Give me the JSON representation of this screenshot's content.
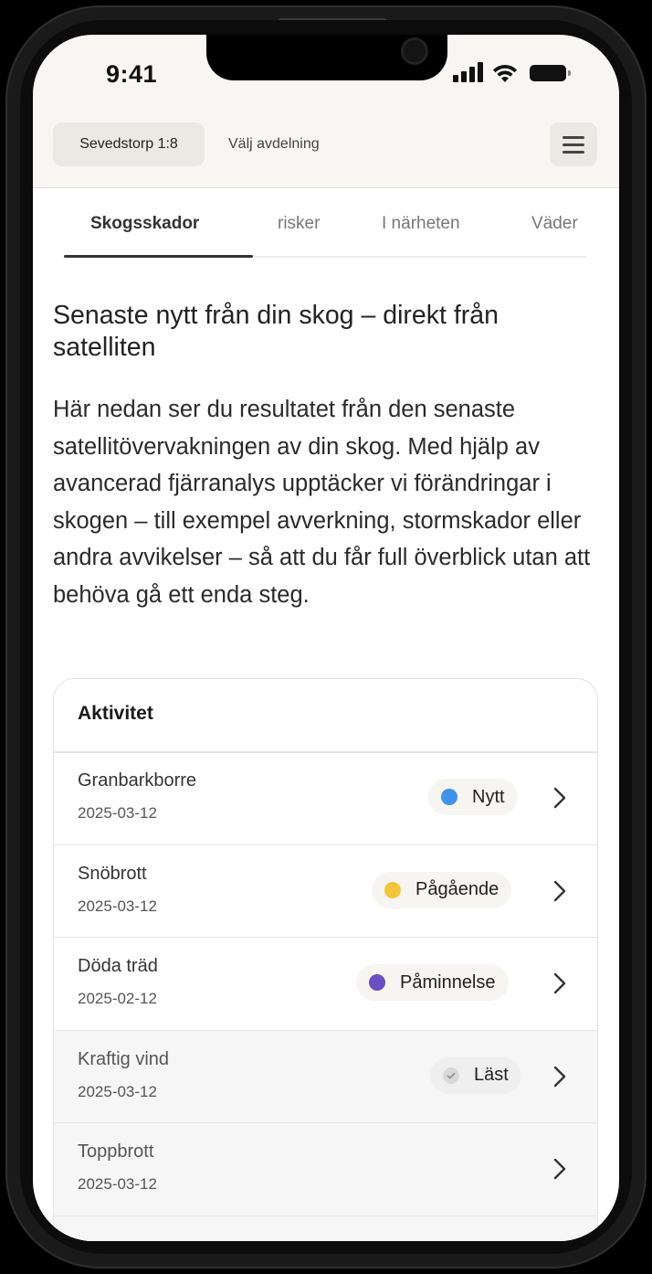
{
  "status_bar": {
    "time": "9:41"
  },
  "header": {
    "property": "Sevedstorp 1:8",
    "department_link": "Välj avdelning"
  },
  "tabs": [
    {
      "label": "Skogsskador",
      "active": true
    },
    {
      "label": "risker",
      "active": false
    },
    {
      "label": "I närheten",
      "active": false
    },
    {
      "label": "Väder",
      "active": false
    }
  ],
  "main": {
    "heading": "Senaste nytt från din skog – direkt från satelliten",
    "intro": "Här nedan ser du resultatet från den senaste satellitövervakningen av din skog. Med hjälp av avancerad fjärranalys upptäcker vi förändringar i skogen – till exempel avverkning, stormskador eller andra avvikelser – så att du får full överblick utan att behöva gå ett enda steg."
  },
  "activity": {
    "title": "Aktivitet",
    "items": [
      {
        "title": "Granbarkborre",
        "date": "2025-03-12",
        "status": "Nytt",
        "status_color": "#3f93e8",
        "read": false
      },
      {
        "title": "Snöbrott",
        "date": "2025-03-12",
        "status": "Pågående",
        "status_color": "#f2c53d",
        "read": false
      },
      {
        "title": "Döda träd",
        "date": "2025-02-12",
        "status": "Påminnelse",
        "status_color": "#6a4fc4",
        "read": false
      },
      {
        "title": "Kraftig vind",
        "date": "2025-03-12",
        "status": "Läst",
        "status_color": "#d9d9d9",
        "read": true
      },
      {
        "title": "Toppbrott",
        "date": "2025-03-12",
        "status": "",
        "read": true
      }
    ]
  },
  "icons": {
    "menu": "hamburger-menu-icon",
    "row_action": "chevron-right-icon",
    "read_status": "check-icon"
  }
}
